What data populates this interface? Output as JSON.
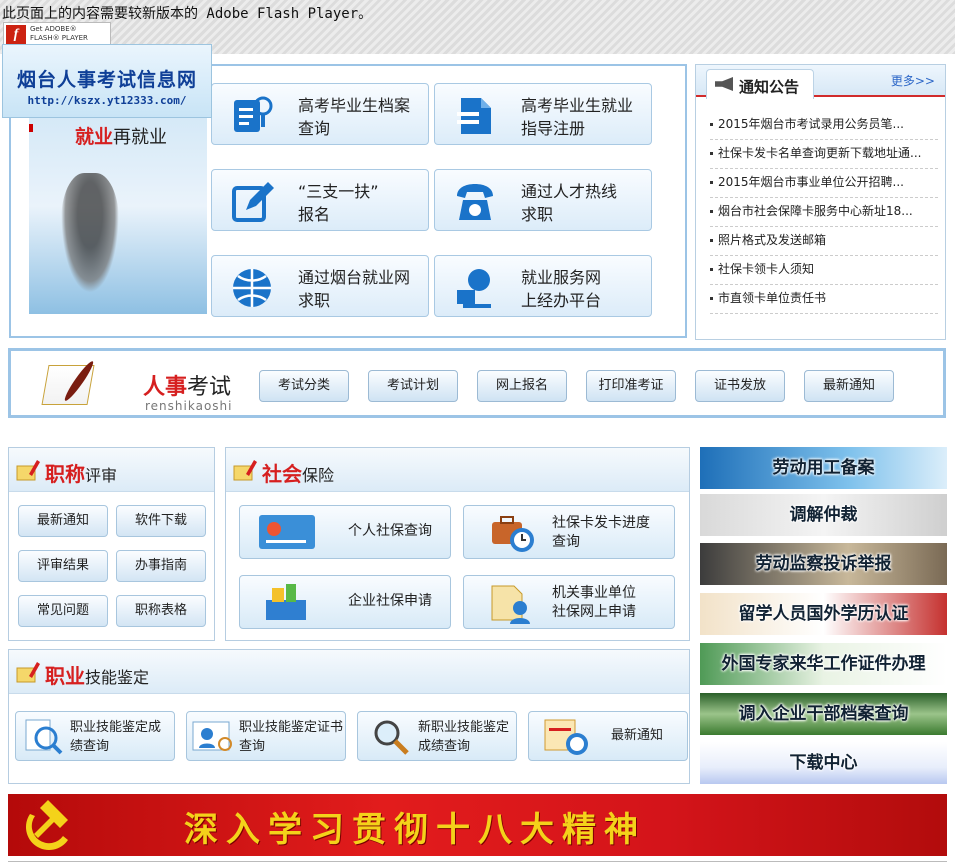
{
  "flash": {
    "message": "此页面上的内容需要较新版本的 Adobe Flash Player。",
    "badge_line1": "Get ADOBE®",
    "badge_line2": "FLASH® PLAYER"
  },
  "logo": {
    "name": "烟台人事考试信息网",
    "url": "http://kszx.yt12333.com/"
  },
  "jiuye": {
    "highlight": "就业",
    "rest": "再就业"
  },
  "services": [
    {
      "line1": "高考毕业生档案",
      "line2": "查询",
      "icon": "person-search-icon"
    },
    {
      "line1": "高考毕业生就业",
      "line2": "指导注册",
      "icon": "document-icon"
    },
    {
      "line1": "“三支一扶”",
      "line2": "报名",
      "icon": "edit-icon"
    },
    {
      "line1": "通过人才热线",
      "line2": "求职",
      "icon": "phone-icon"
    },
    {
      "line1": "通过烟台就业网",
      "line2": "求职",
      "icon": "globe-icon"
    },
    {
      "line1": "就业服务网",
      "line2": "上经办平台",
      "icon": "user-computer-icon"
    }
  ],
  "notice": {
    "title": "通知公告",
    "more": "更多>>",
    "items": [
      "2015年烟台市考试录用公务员笔...",
      "社保卡发卡名单查询更新下载地址通...",
      "2015年烟台市事业单位公开招聘...",
      "烟台市社会保障卡服务中心新址18...",
      "照片格式及发送邮箱",
      "社保卡领卡人须知",
      "市直领卡单位责任书"
    ]
  },
  "exam": {
    "title_red": "人事",
    "title_rest": "考试",
    "pinyin": "renshikaoshi",
    "buttons": [
      "考试分类",
      "考试计划",
      "网上报名",
      "打印准考证",
      "证书发放",
      "最新通知"
    ]
  },
  "zhicheng": {
    "title_red": "职称",
    "title_rest": "评审",
    "buttons": [
      "最新通知",
      "软件下载",
      "评审结果",
      "办事指南",
      "常见问题",
      "职称表格"
    ]
  },
  "shebao": {
    "title_red": "社会",
    "title_rest": "保险",
    "buttons": [
      {
        "line1": "个人社保查询",
        "line2": ""
      },
      {
        "line1": "社保卡发卡进度",
        "line2": "查询"
      },
      {
        "line1": "企业社保申请",
        "line2": ""
      },
      {
        "line1": "机关事业单位",
        "line2": "社保网上申请"
      }
    ]
  },
  "zhiye": {
    "title_red": "职业",
    "title_rest": "技能鉴定",
    "buttons": [
      {
        "line1": "职业技能鉴定成",
        "line2": "绩查询"
      },
      {
        "line1": "职业技能鉴定证书",
        "line2": "查询"
      },
      {
        "line1": "新职业技能鉴定",
        "line2": "成绩查询"
      },
      {
        "line1": "最新通知",
        "line2": ""
      }
    ]
  },
  "right_banners": [
    "劳动用工备案",
    "调解仲裁",
    "劳动监察投诉举报",
    "留学人员国外学历认证",
    "外国专家来华工作证件办理",
    "调入企业干部档案查询",
    "下载中心"
  ],
  "party_banner": {
    "slogan": "深入学习贯彻十八大精神"
  },
  "colors": {
    "accent_red": "#d61f1f",
    "border_blue": "#9cc4e6",
    "logo_blue": "#0f3f97",
    "slogan_gold": "#f4d21a"
  }
}
